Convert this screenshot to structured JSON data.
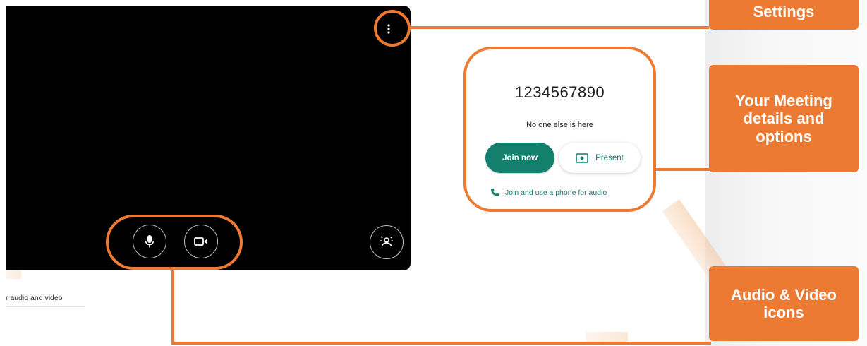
{
  "meeting": {
    "code": "1234567890",
    "status": "No one else is here",
    "join_label": "Join now",
    "present_label": "Present",
    "phone_link_label": "Join and use a phone for audio"
  },
  "video": {
    "caption": "r audio and video"
  },
  "callouts": {
    "settings": "Settings",
    "meeting_details": "Your Meeting details and options",
    "audio_video": "Audio & Video icons"
  },
  "icons": {
    "more_options": "vertical-dots-icon",
    "microphone": "microphone-icon",
    "camera": "video-camera-icon",
    "effects": "visual-effects-icon",
    "present": "present-screen-icon",
    "phone": "phone-icon"
  },
  "colors": {
    "annotation_orange": "#ec7a33",
    "meet_green": "#137f6d",
    "video_background": "#000000"
  }
}
